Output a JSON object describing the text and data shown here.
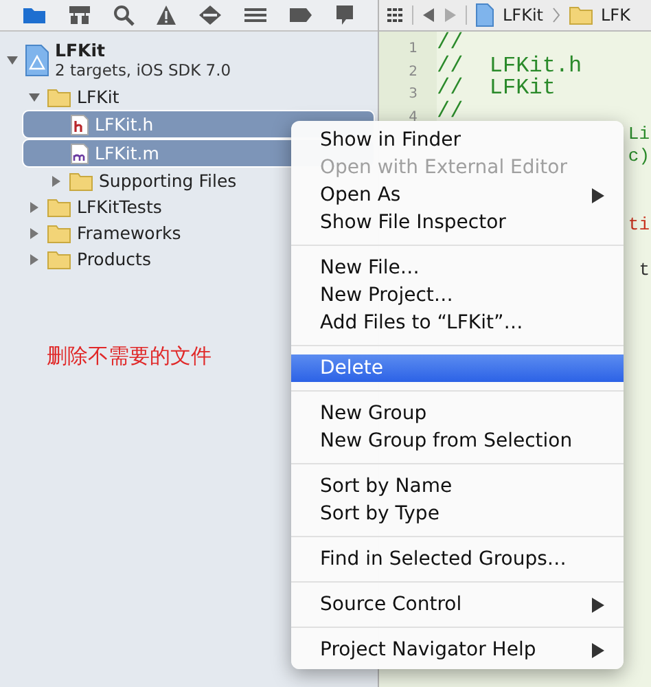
{
  "navigator_tabs": [
    {
      "kind": "folder",
      "selected": true
    },
    {
      "kind": "hierarchy",
      "selected": false
    },
    {
      "kind": "search",
      "selected": false
    },
    {
      "kind": "warning",
      "selected": false
    },
    {
      "kind": "diamond",
      "selected": false
    },
    {
      "kind": "list",
      "selected": false
    },
    {
      "kind": "tag",
      "selected": false
    },
    {
      "kind": "bubble",
      "selected": false
    }
  ],
  "project": {
    "name": "LFKit",
    "subtitle": "2 targets, iOS SDK 7.0",
    "expanded": true,
    "children": [
      {
        "name": "LFKit",
        "kind": "folder",
        "expanded": true,
        "selected": false,
        "children": [
          {
            "name": "LFKit.h",
            "kind": "header",
            "selected": true
          },
          {
            "name": "LFKit.m",
            "kind": "source",
            "selected": true
          },
          {
            "name": "Supporting Files",
            "kind": "folder",
            "expanded": false,
            "selected": false
          }
        ]
      },
      {
        "name": "LFKitTests",
        "kind": "folder",
        "expanded": false,
        "selected": false
      },
      {
        "name": "Frameworks",
        "kind": "folder",
        "expanded": false,
        "selected": false
      },
      {
        "name": "Products",
        "kind": "folder",
        "expanded": false,
        "selected": false
      }
    ]
  },
  "annotation": "删除不需要的文件",
  "editor": {
    "breadcrumb": [
      "LFKit",
      "LFK"
    ],
    "lines": [
      {
        "kind": "code",
        "number": "1",
        "text": "//"
      },
      {
        "kind": "code",
        "number": "2",
        "text": "//  LFKit.h"
      },
      {
        "kind": "code",
        "number": "3",
        "text": "//  LFKit"
      },
      {
        "kind": "code",
        "number": "4",
        "text": "//"
      },
      {
        "kind": "tail",
        "text": "Li",
        "color": "#2a8a2a"
      },
      {
        "kind": "tail",
        "text": "c)",
        "color": "#2a8a2a"
      },
      {
        "kind": "blank"
      },
      {
        "kind": "blank"
      },
      {
        "kind": "tail",
        "text": "ti",
        "color": "#c8321e"
      },
      {
        "kind": "blank"
      },
      {
        "kind": "tail",
        "text": "t",
        "color": "#333333"
      }
    ]
  },
  "context_menu": [
    [
      {
        "label": "Show in Finder",
        "disabled": false,
        "submenu": false,
        "selected": false
      },
      {
        "label": "Open with External Editor",
        "disabled": true,
        "submenu": false,
        "selected": false
      },
      {
        "label": "Open As",
        "disabled": false,
        "submenu": true,
        "selected": false
      },
      {
        "label": "Show File Inspector",
        "disabled": false,
        "submenu": false,
        "selected": false
      }
    ],
    [
      {
        "label": "New File…",
        "disabled": false,
        "submenu": false,
        "selected": false
      },
      {
        "label": "New Project…",
        "disabled": false,
        "submenu": false,
        "selected": false
      },
      {
        "label": "Add Files to “LFKit”…",
        "disabled": false,
        "submenu": false,
        "selected": false
      }
    ],
    [
      {
        "label": "Delete",
        "disabled": false,
        "submenu": false,
        "selected": true
      }
    ],
    [
      {
        "label": "New Group",
        "disabled": false,
        "submenu": false,
        "selected": false
      },
      {
        "label": "New Group from Selection",
        "disabled": false,
        "submenu": false,
        "selected": false
      }
    ],
    [
      {
        "label": "Sort by Name",
        "disabled": false,
        "submenu": false,
        "selected": false
      },
      {
        "label": "Sort by Type",
        "disabled": false,
        "submenu": false,
        "selected": false
      }
    ],
    [
      {
        "label": "Find in Selected Groups…",
        "disabled": false,
        "submenu": false,
        "selected": false
      }
    ],
    [
      {
        "label": "Source Control",
        "disabled": false,
        "submenu": true,
        "selected": false
      }
    ],
    [
      {
        "label": "Project Navigator Help",
        "disabled": false,
        "submenu": true,
        "selected": false
      }
    ]
  ]
}
